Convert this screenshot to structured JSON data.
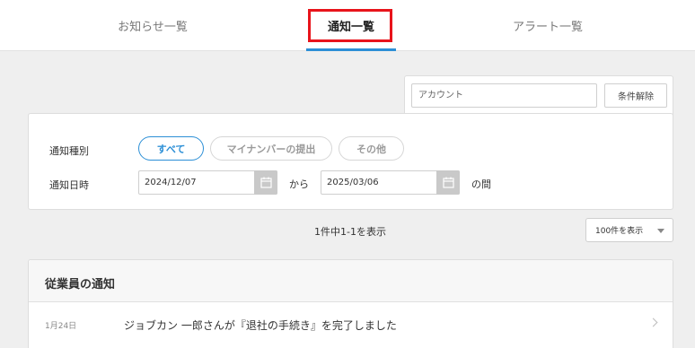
{
  "tabs": [
    {
      "label": "お知らせ一覧"
    },
    {
      "label": "通知一覧"
    },
    {
      "label": "アラート一覧"
    }
  ],
  "account_filter": {
    "placeholder": "アカウント",
    "clear_label": "条件解除"
  },
  "filters": {
    "type_label": "通知種別",
    "types": [
      {
        "label": "すべて",
        "selected": true
      },
      {
        "label": "マイナンバーの提出",
        "selected": false
      },
      {
        "label": "その他",
        "selected": false
      }
    ],
    "date_label": "通知日時",
    "date_from": "2024/12/07",
    "from_word": "から",
    "date_to": "2025/03/06",
    "between_word": "の間"
  },
  "result_count": "1件中1-1を表示",
  "per_page": "100件を表示",
  "section": {
    "title": "従業員の通知",
    "rows": [
      {
        "date": "1月24日",
        "text": "ジョブカン 一郎さんが『退社の手続き』を完了しました"
      }
    ]
  },
  "colors": {
    "accent": "#2c8fd6",
    "highlight": "#e8141b"
  }
}
